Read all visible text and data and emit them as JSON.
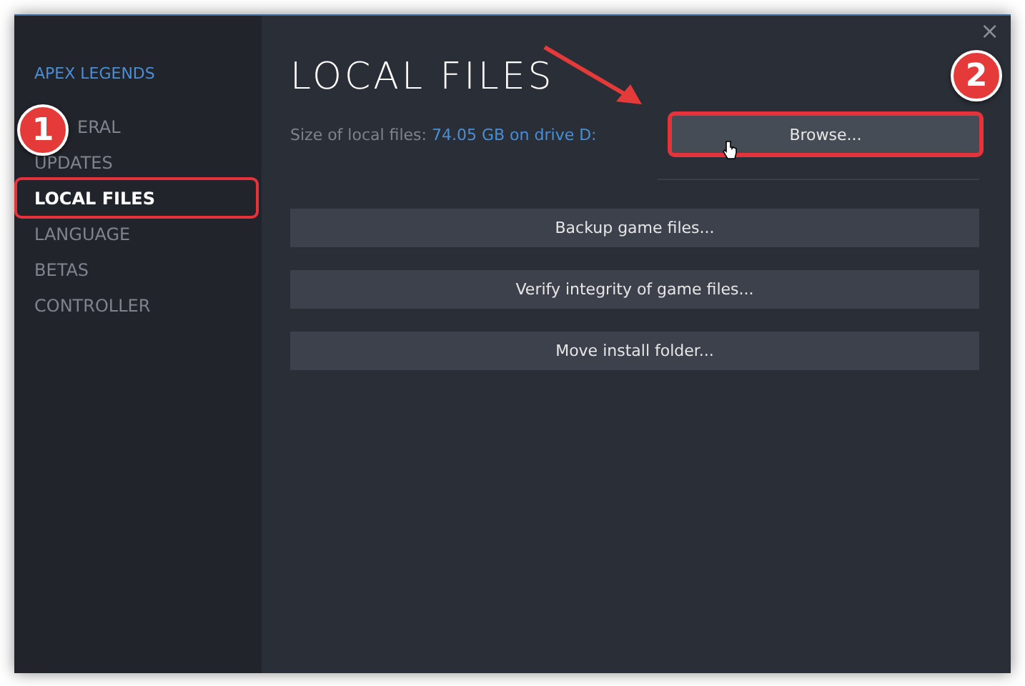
{
  "sidebar": {
    "game_title": "APEX LEGENDS",
    "items": [
      {
        "label": "ERAL",
        "selected": false,
        "badge": "1"
      },
      {
        "label": "UPDATES",
        "selected": false
      },
      {
        "label": "LOCAL FILES",
        "selected": true
      },
      {
        "label": "LANGUAGE",
        "selected": false
      },
      {
        "label": "BETAS",
        "selected": false
      },
      {
        "label": "CONTROLLER",
        "selected": false
      }
    ]
  },
  "main": {
    "title": "LOCAL FILES",
    "size_label": "Size of local files:",
    "size_value": "74.05 GB on drive D:",
    "browse": {
      "label": "Browse...",
      "badge": "2"
    },
    "buttons": [
      "Backup game files...",
      "Verify integrity of game files...",
      "Move install folder..."
    ]
  },
  "close": "×"
}
